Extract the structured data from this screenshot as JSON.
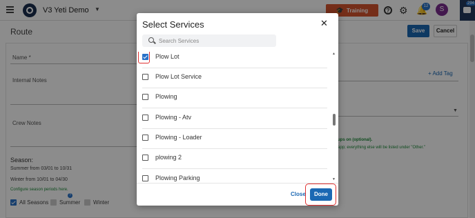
{
  "header": {
    "app_title": "V3 Yeti Demo",
    "training_label": "Training",
    "notification_count": "12",
    "avatar_initial": "S",
    "chat_count": "294"
  },
  "page": {
    "title": "Route",
    "save_label": "Save",
    "cancel_label": "Cancel",
    "name_label": "Name *",
    "internal_notes_label": "Internal Notes",
    "crew_notes_label": "Crew Notes",
    "add_tag_label": "+ Add Tag",
    "green_note_1": "ups on (optional).",
    "green_note_2": "app; everything else will be listed under \"Other.\"",
    "season": {
      "title": "Season:",
      "summer": "Summer from 03/01 to 10/31",
      "winter": "Winter from 10/01 to 04/30",
      "configure_link": "Configure season periods here.",
      "options": [
        {
          "label": "All Seasons",
          "checked": true
        },
        {
          "label": "Summer",
          "checked": false
        },
        {
          "label": "Winter",
          "checked": false
        }
      ]
    }
  },
  "modal": {
    "title": "Select Services",
    "search_placeholder": "Search Services",
    "services": [
      {
        "label": "Plow Lot",
        "checked": true
      },
      {
        "label": "Plow Lot Service",
        "checked": false
      },
      {
        "label": "Plowing",
        "checked": false
      },
      {
        "label": "Plowing - Atv",
        "checked": false
      },
      {
        "label": "Plowing - Loader",
        "checked": false
      },
      {
        "label": "plowing 2",
        "checked": false
      },
      {
        "label": "Plowing Parking",
        "checked": false
      }
    ],
    "close_label": "Close",
    "done_label": "Done"
  }
}
